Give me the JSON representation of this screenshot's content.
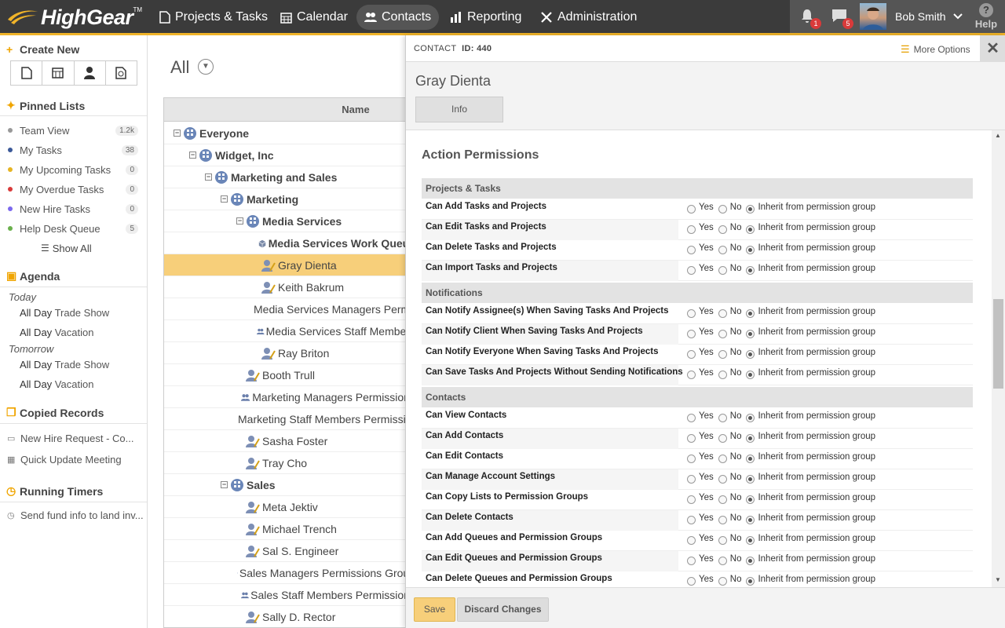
{
  "app": {
    "brand": "HighGear",
    "tm": "TM"
  },
  "nav": {
    "items": [
      "Projects & Tasks",
      "Calendar",
      "Contacts",
      "Reporting",
      "Administration"
    ],
    "active": "Contacts"
  },
  "header": {
    "notifications_count": "1",
    "messages_count": "5",
    "user_name": "Bob Smith",
    "help_label": "Help"
  },
  "colors": {
    "accent": "#f0b429",
    "topbar": "#3b3b3b",
    "selected_row": "#f7cf7a",
    "badge": "#d93a3a"
  },
  "sidebar": {
    "create_new": "Create New",
    "create_icons": [
      "document-icon",
      "calendar-icon",
      "person-icon",
      "copy-document-icon"
    ],
    "pinned_title": "Pinned Lists",
    "pinned": [
      {
        "label": "Team View",
        "count": "1.2k",
        "color": "#999999"
      },
      {
        "label": "My Tasks",
        "count": "38",
        "color": "#3b5998"
      },
      {
        "label": "My Upcoming Tasks",
        "count": "0",
        "color": "#e6b422"
      },
      {
        "label": "My Overdue Tasks",
        "count": "0",
        "color": "#d93a3a"
      },
      {
        "label": "New Hire Tasks",
        "count": "0",
        "color": "#7b68ee"
      },
      {
        "label": "Help Desk Queue",
        "count": "5",
        "color": "#6ab04c"
      }
    ],
    "show_all": "Show All",
    "agenda_title": "Agenda",
    "agenda": {
      "today_label": "Today",
      "today": [
        {
          "bold": "All Day",
          "text": " Trade Show"
        },
        {
          "bold": "All Day",
          "text": " Vacation"
        }
      ],
      "tomorrow_label": "Tomorrow",
      "tomorrow": [
        {
          "bold": "All Day",
          "text": " Trade Show"
        },
        {
          "bold": "All Day",
          "text": " Vacation"
        }
      ]
    },
    "copied_title": "Copied Records",
    "copied": [
      "New Hire Request - Co...",
      "Quick Update Meeting"
    ],
    "timers_title": "Running Timers",
    "timers": [
      "Send fund info to land inv..."
    ]
  },
  "main": {
    "title": "All",
    "column_name": "Name",
    "tree": [
      {
        "label": "Everyone",
        "level": 0,
        "type": "group",
        "bold": true
      },
      {
        "label": "Widget, Inc",
        "level": 1,
        "type": "group",
        "bold": true
      },
      {
        "label": "Marketing and Sales",
        "level": 2,
        "type": "group",
        "bold": true
      },
      {
        "label": "Marketing",
        "level": 3,
        "type": "group",
        "bold": true
      },
      {
        "label": "Media Services",
        "level": 4,
        "type": "group",
        "bold": true
      },
      {
        "label": "Media Services Work Queue",
        "level": 5,
        "type": "queue",
        "bold": true
      },
      {
        "label": "Gray Dienta",
        "level": 5,
        "type": "person",
        "selected": true
      },
      {
        "label": "Keith Bakrum",
        "level": 5,
        "type": "person"
      },
      {
        "label": "Media Services Managers Permissions",
        "level": 5,
        "type": "people"
      },
      {
        "label": "Media Services Staff Members",
        "level": 5,
        "type": "people"
      },
      {
        "label": "Ray Briton",
        "level": 5,
        "type": "person"
      },
      {
        "label": "Booth Trull",
        "level": 4,
        "type": "person"
      },
      {
        "label": "Marketing Managers Permissions",
        "level": 4,
        "type": "people"
      },
      {
        "label": "Marketing Staff Members Permissions",
        "level": 4,
        "type": "people"
      },
      {
        "label": "Sasha Foster",
        "level": 4,
        "type": "person"
      },
      {
        "label": "Tray Cho",
        "level": 4,
        "type": "person"
      },
      {
        "label": "Sales",
        "level": 3,
        "type": "group",
        "bold": true
      },
      {
        "label": "Meta Jektiv",
        "level": 4,
        "type": "person"
      },
      {
        "label": "Michael Trench",
        "level": 4,
        "type": "person"
      },
      {
        "label": "Sal S. Engineer",
        "level": 4,
        "type": "person"
      },
      {
        "label": "Sales Managers Permissions Group",
        "level": 4,
        "type": "people"
      },
      {
        "label": "Sales Staff Members Permissions",
        "level": 4,
        "type": "people"
      },
      {
        "label": "Sally D. Rector",
        "level": 4,
        "type": "person"
      }
    ]
  },
  "panel": {
    "contact_label": "CONTACT",
    "id_label": "ID: 440",
    "more_options": "More Options",
    "name": "Gray Dienta",
    "info_tab": "Info",
    "section_title": "Action Permissions",
    "radio_labels": [
      "Yes",
      "No",
      "Inherit from permission group"
    ],
    "groups": [
      {
        "title": "Projects & Tasks",
        "rows": [
          "Can Add Tasks and Projects",
          "Can Edit Tasks and Projects",
          "Can Delete Tasks and Projects",
          "Can Import Tasks and Projects"
        ]
      },
      {
        "title": "Notifications",
        "rows": [
          "Can Notify Assignee(s) When Saving Tasks And Projects",
          "Can Notify Client When Saving Tasks And Projects",
          "Can Notify Everyone When Saving Tasks And Projects",
          "Can Save Tasks And Projects Without Sending Notifications"
        ]
      },
      {
        "title": "Contacts",
        "rows": [
          "Can View Contacts",
          "Can Add Contacts",
          "Can Edit Contacts",
          "Can Manage Account Settings",
          "Can Copy Lists to Permission Groups",
          "Can Delete Contacts",
          "Can Add Queues and Permission Groups",
          "Can Edit Queues and Permission Groups",
          "Can Delete Queues and Permission Groups"
        ]
      }
    ],
    "selected_option": "Inherit from permission group",
    "save": "Save",
    "discard": "Discard Changes"
  }
}
